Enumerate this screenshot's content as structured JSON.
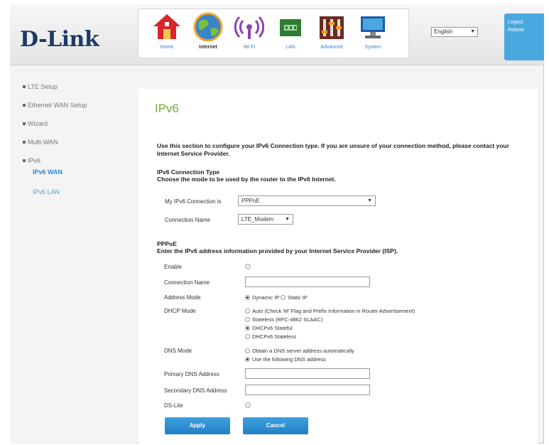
{
  "brand": {
    "logo": "D-Link"
  },
  "nav": [
    {
      "label": "Home",
      "icon": "home-icon"
    },
    {
      "label": "Internet",
      "icon": "internet-globe-icon"
    },
    {
      "label": "Wi-Fi",
      "icon": "wifi-icon"
    },
    {
      "label": "LAN",
      "icon": "lan-icon"
    },
    {
      "label": "Advanced",
      "icon": "advanced-icon"
    },
    {
      "label": "System",
      "icon": "system-icon"
    }
  ],
  "language": "English",
  "logout": {
    "line1": "Logout",
    "line2": "Reboot"
  },
  "sidebar": {
    "items": [
      "LTE Setup",
      "Ethernet WAN Setup",
      "Wizard",
      "Multi-WAN",
      "IPv6"
    ],
    "subitems": [
      "IPv6 WAN",
      "IPv6 LAN"
    ]
  },
  "page": {
    "title": "IPv6",
    "intro": "Use this section to configure your IPv6 Connection type. If you are unsure of your connection method, please contact your Internet Service Provider.",
    "conn_type_heading": "IPv6 Connection Type",
    "conn_type_desc": "Choose the mode to be used by the router to the IPv6 Internet.",
    "my_conn_label": "My IPv6 Connection is",
    "my_conn_value": "PPPoE",
    "conn_name_label": "Connection Name",
    "conn_name_value": "LTE_Modem",
    "pppoe_heading": "PPPoE",
    "pppoe_desc": "Enter the IPv6 address information provided by your Internet Service Provider (ISP)."
  },
  "form": {
    "enable": "Enable",
    "connection_name": "Connection Name",
    "address_mode": "Address Mode",
    "address_mode_options": [
      "Dynamic IP",
      "Static IP"
    ],
    "dhcp_mode": "DHCP Mode",
    "dhcp_options": [
      "Auto (Check 'M' Flag and Prefix Information in Router Advertisement)",
      "Stateless (RFC-4862 SLAAC)",
      "DHCPv6 Stateful",
      "DHCPv6 Stateless"
    ],
    "dns_mode": "DNS Mode",
    "dns_options": [
      "Obtain a DNS server address automatically",
      "Use the following DNS address"
    ],
    "primary_dns": "Primary DNS Address",
    "secondary_dns": "Secondary DNS Address",
    "ds_lite": "DS-Lite"
  },
  "buttons": {
    "apply": "Apply",
    "cancel": "Cancel"
  }
}
